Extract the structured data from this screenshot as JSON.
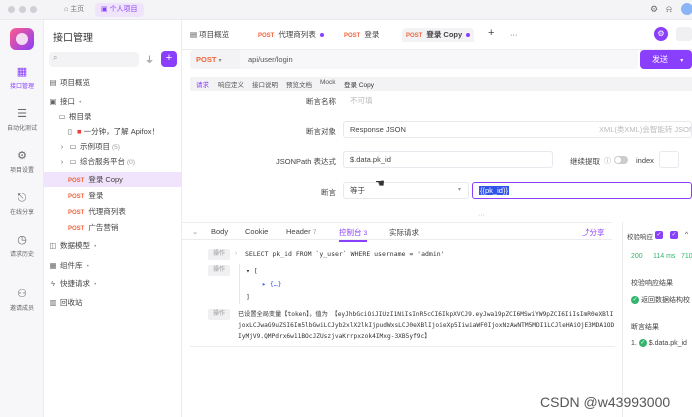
{
  "topbar": {
    "home": "主页",
    "project": "个人项目"
  },
  "rail": [
    {
      "label": "接口管理",
      "icon": "api-icon"
    },
    {
      "label": "自动化测试",
      "icon": "auto-test-icon"
    },
    {
      "label": "项目设置",
      "icon": "settings-icon"
    },
    {
      "label": "在线分享",
      "icon": "share-icon"
    },
    {
      "label": "请求历史",
      "icon": "history-icon"
    },
    {
      "label": "邀请成员",
      "icon": "invite-icon"
    }
  ],
  "sidebar": {
    "title": "接口管理",
    "tree": [
      {
        "label": "项目概览"
      },
      {
        "label": "接口",
        "suffix": "•"
      },
      {
        "label": "根目录"
      },
      {
        "label": "一分钟，了解 Apifox！",
        "mark": "■"
      },
      {
        "label": "示例项目",
        "count": "(5)"
      },
      {
        "label": "综合服务平台",
        "count": "(0)"
      },
      {
        "method": "POST",
        "label": "登录 Copy"
      },
      {
        "method": "POST",
        "label": "登录"
      },
      {
        "method": "POST",
        "label": "代理商列表"
      },
      {
        "method": "POST",
        "label": "广告营销"
      },
      {
        "label": "数据模型",
        "suffix": "•"
      },
      {
        "label": "组件库",
        "suffix": "•"
      },
      {
        "label": "快捷请求",
        "suffix": "•"
      },
      {
        "label": "回收站"
      }
    ]
  },
  "tabs": [
    {
      "label": "项目概览"
    },
    {
      "method": "POST",
      "label": "代理商列表"
    },
    {
      "method": "POST",
      "label": "登录"
    },
    {
      "method": "POST",
      "label": "登录 Copy"
    }
  ],
  "request": {
    "method": "POST",
    "url": "api/user/login",
    "send": "发送"
  },
  "subtabs": [
    "请求",
    "响应定义",
    "接口说明",
    "预览文档",
    "Mock",
    "登录 Copy"
  ],
  "assertion": {
    "name_label": "断言名称",
    "name_placeholder": "不可填",
    "target_label": "断言对象",
    "target_value": "Response JSON",
    "target_hint": "XML(类XML)会智能转 JSON",
    "jsonpath_label": "JSONPath 表达式",
    "jsonpath_value": "$.data.pk_id",
    "continue_label": "继续提取",
    "index_label": "index",
    "assert_label": "断言",
    "operator": "等于",
    "value": "{{pk_id}}"
  },
  "response": {
    "tabs": [
      "Body",
      "Cookie",
      "Header",
      "控制台",
      "实际请求"
    ],
    "header_count": "7",
    "console_count": "3",
    "share": "分享",
    "tag": "操作",
    "log1": "SELECT pk_id FROM `y_user` WHERE username = 'admin'",
    "log2_open": "▾ [",
    "log2_obj": "▸ {…}",
    "log2_close": "]",
    "log3_text": "已设置全局变量【token】，值为 【eyJhbGciOiJIUzI1NiIsInR5cCI6IkpXVCJ9.eyJwa19pZCI6MSwiYW9pZCI6IiIsImR0eXBlIjoxLCJwaG9uZSI6Im5lbGwiLCJyb2xlX2lkIjpudWxsLCJ0eXBlIjoieXp5IiwiaWF0IjoxNzAwNTM5MDI1LCJleHAiOjE3MDA1ODIyMjV9.QMPdrx6w11BOcJZUszjvaKrrpxzok4IMxg-3XB5yf9c】"
  },
  "rightpanel": {
    "validate": "校验响应",
    "status": "200",
    "time": "114 ms",
    "size": "710",
    "validate_result": "校验响应结果",
    "validate_ok": "返回数据结构校",
    "assert_result": "断言结果",
    "assert_item": "1.",
    "assert_expr": "$.data.pk_id"
  },
  "watermark": "CSDN @w43993000",
  "colors": {
    "accent": "#8a3ffc",
    "post": "#f0643b",
    "ok": "#35b46f"
  }
}
